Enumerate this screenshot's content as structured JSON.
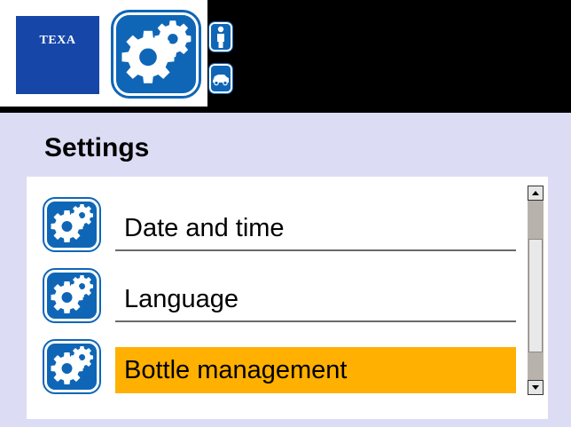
{
  "header": {
    "brand": "TEXA",
    "main_icon": "gears-icon",
    "user_icon": "person-icon",
    "vehicle_icon": "car-icon"
  },
  "page": {
    "title": "Settings"
  },
  "menu": {
    "items": [
      {
        "label": "Date and time",
        "icon": "gears-icon",
        "selected": false
      },
      {
        "label": "Language",
        "icon": "gears-icon",
        "selected": false
      },
      {
        "label": "Bottle management",
        "icon": "gears-icon",
        "selected": true
      }
    ]
  },
  "colors": {
    "brand_blue": "#1646a8",
    "icon_blue": "#0f66b6",
    "selection": "#ffb000",
    "background": "#dcdcf5"
  }
}
